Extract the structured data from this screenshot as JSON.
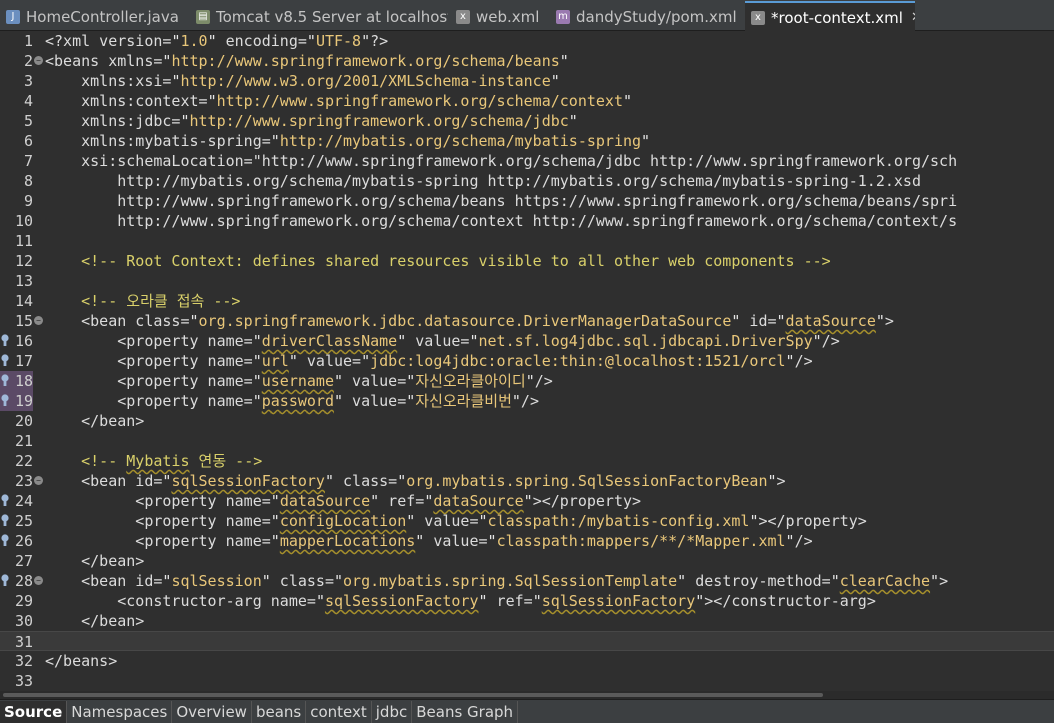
{
  "tabs": [
    {
      "label": "HomeController.java",
      "icon": "java-file-icon",
      "active": false
    },
    {
      "label": "Tomcat v8.5 Server at localhost",
      "icon": "server-icon",
      "active": false
    },
    {
      "label": "web.xml",
      "icon": "xml-file-icon",
      "active": false
    },
    {
      "label": "dandyStudy/pom.xml",
      "icon": "maven-pom-icon",
      "active": false
    },
    {
      "label": "*root-context.xml",
      "icon": "xml-file-icon",
      "active": true
    }
  ],
  "bottom_tabs": [
    "Source",
    "Namespaces",
    "Overview",
    "beans",
    "context",
    "jdbc",
    "Beans Graph"
  ],
  "active_bottom_tab": "Source",
  "editor": {
    "current_line": 31,
    "lines": [
      "<?xml version=\"1.0\" encoding=\"UTF-8\"?>",
      "<beans xmlns=\"http://www.springframework.org/schema/beans\"",
      "    xmlns:xsi=\"http://www.w3.org/2001/XMLSchema-instance\"",
      "    xmlns:context=\"http://www.springframework.org/schema/context\"",
      "    xmlns:jdbc=\"http://www.springframework.org/schema/jdbc\"",
      "    xmlns:mybatis-spring=\"http://mybatis.org/schema/mybatis-spring\"",
      "    xsi:schemaLocation=\"http://www.springframework.org/schema/jdbc http://www.springframework.org/sch",
      "        http://mybatis.org/schema/mybatis-spring http://mybatis.org/schema/mybatis-spring-1.2.xsd",
      "        http://www.springframework.org/schema/beans https://www.springframework.org/schema/beans/spri",
      "        http://www.springframework.org/schema/context http://www.springframework.org/schema/context/s",
      "",
      "    <!-- Root Context: defines shared resources visible to all other web components -->",
      "",
      "    <!-- 오라클 접속 -->",
      "    <bean class=\"org.springframework.jdbc.datasource.DriverManagerDataSource\" id=\"dataSource\">",
      "        <property name=\"driverClassName\" value=\"net.sf.log4jdbc.sql.jdbcapi.DriverSpy\"/>",
      "        <property name=\"url\" value=\"jdbc:log4jdbc:oracle:thin:@localhost:1521/orcl\"/>",
      "        <property name=\"username\" value=\"자신오라클아이디\"/>",
      "        <property name=\"password\" value=\"자신오라클비번\"/>",
      "    </bean>",
      "",
      "    <!-- Mybatis 연동 -->",
      "    <bean id=\"sqlSessionFactory\" class=\"org.mybatis.spring.SqlSessionFactoryBean\">",
      "          <property name=\"dataSource\" ref=\"dataSource\"></property>",
      "          <property name=\"configLocation\" value=\"classpath:/mybatis-config.xml\"></property>",
      "          <property name=\"mapperLocations\" value=\"classpath:mappers/**/*Mapper.xml\"/>",
      "    </bean>",
      "    <bean id=\"sqlSession\" class=\"org.mybatis.spring.SqlSessionTemplate\" destroy-method=\"clearCache\">",
      "        <constructor-arg name=\"sqlSessionFactory\" ref=\"sqlSessionFactory\"></constructor-arg>",
      "    </bean>",
      "",
      "</beans>",
      ""
    ],
    "fold_lines": [
      2,
      15,
      23,
      28
    ],
    "breakpoint_lines": [
      16,
      17,
      18,
      19,
      24,
      25,
      26,
      28
    ],
    "highlighted_line_numbers": [
      18,
      19
    ],
    "squiggle_words": [
      "driverClassName",
      "url",
      "username",
      "password",
      "Mybatis",
      "sqlSessionFactory",
      "dataSource",
      "configLocation",
      "mapperLocations",
      "clearCache"
    ]
  },
  "colors": {
    "background": "#2f2f2f",
    "tag": "#dcdcdc",
    "attribute_value": "#e9c77a",
    "comment": "#d9d06a",
    "active_tab_accent": "#5a9bd5"
  }
}
